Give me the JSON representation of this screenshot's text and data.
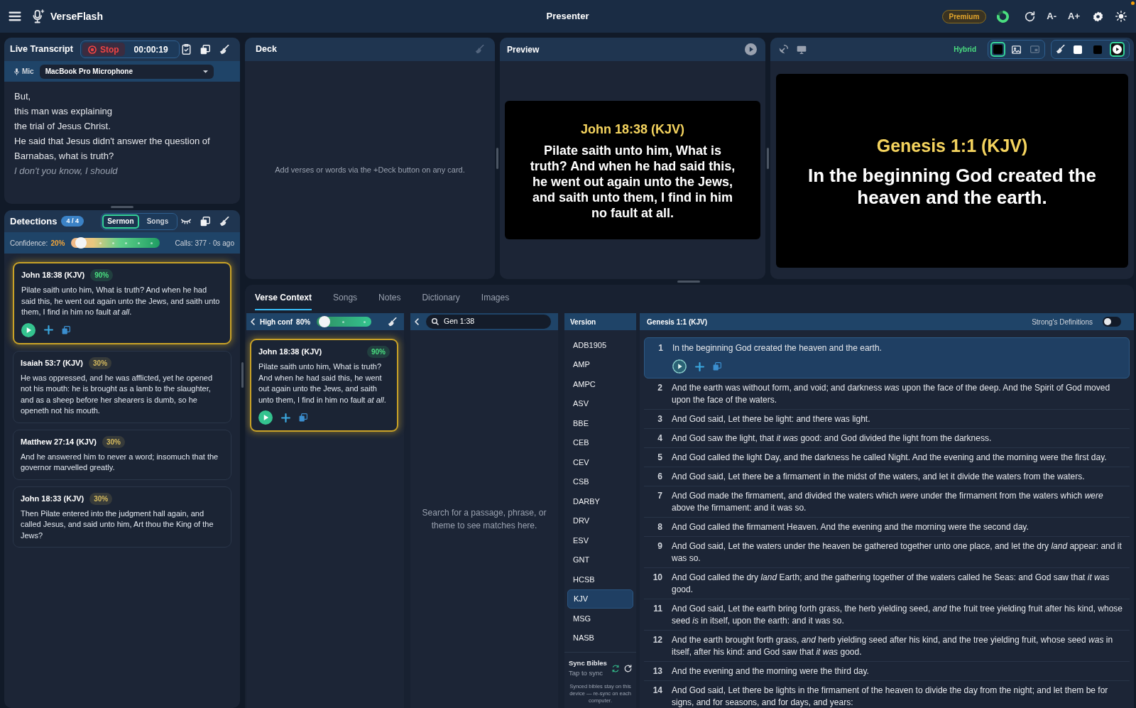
{
  "app_bar": {
    "app_name": "VerseFlash",
    "title": "Presenter",
    "premium": "Premium",
    "font_smaller": "A-",
    "font_larger": "A+"
  },
  "live_transcript": {
    "title": "Live Transcript",
    "stop": "Stop",
    "timer": "00:00:19",
    "mic_label": "Mic",
    "microphone": "MacBook Pro Microphone",
    "lines": [
      {
        "text": "But,",
        "interim": false
      },
      {
        "text": "this man was explaining",
        "interim": false
      },
      {
        "text": "the trial of Jesus Christ.",
        "interim": false
      },
      {
        "text": "He said that Jesus didn't answer the question of Barnabas, what is truth?",
        "interim": false
      },
      {
        "text": "I don't you know, I should",
        "interim": true
      }
    ]
  },
  "detections": {
    "title": "Detections",
    "count": "4 / 4",
    "modes": [
      {
        "label": "Sermon",
        "selected": true
      },
      {
        "label": "Songs",
        "selected": false
      }
    ],
    "confidence": {
      "label": "Confidence:",
      "value": "20%",
      "level": 0.05
    },
    "calls": "Calls: 377 · 0s ago",
    "cards": [
      {
        "reference": "John 18:38 (KJV)",
        "score": "90%",
        "color": "#4ade80",
        "selected": true,
        "text": "Pilate saith unto him, What is truth? And when he had said this, he went out again unto the Jews, and saith unto them, I find in him no fault *at all*."
      },
      {
        "reference": "Isaiah 53:7 (KJV)",
        "score": "30%",
        "color": "#d4b95e",
        "selected": false,
        "text": "He was oppressed, and he was afflicted, yet he opened not his mouth: he is brought as a lamb to the slaughter, and as a sheep before her shearers is dumb, so he openeth not his mouth."
      },
      {
        "reference": "Matthew 27:14 (KJV)",
        "score": "30%",
        "color": "#d4b95e",
        "selected": false,
        "text": "And he answered him to never a word; insomuch that the governor marvelled greatly."
      },
      {
        "reference": "John 18:33 (KJV)",
        "score": "30%",
        "color": "#d4b95e",
        "selected": false,
        "text": "Then Pilate entered into the judgment hall again, and called Jesus, and said unto him, Art thou the King of the Jews?"
      }
    ]
  },
  "deck": {
    "title": "Deck",
    "empty_message": "Add verses or words via the +Deck button on any card."
  },
  "preview": {
    "title": "Preview",
    "reference": "John 18:38 (KJV)",
    "text": "Pilate saith unto him, What is truth? And when he had said this, he went out again unto the Jews, and saith unto them, I find in him no fault at all."
  },
  "output": {
    "mode": "Hybrid",
    "background_modes": [
      {
        "kind": "solid",
        "selected": true,
        "disabled": false
      },
      {
        "kind": "image",
        "selected": false,
        "disabled": false
      },
      {
        "kind": "overlay",
        "selected": false,
        "disabled": true
      }
    ],
    "screen_modes": [
      {
        "kind": "white",
        "selected": false
      },
      {
        "kind": "black",
        "selected": false
      },
      {
        "kind": "live",
        "selected": true
      }
    ],
    "reference": "Genesis 1:1 (KJV)",
    "text": "In the beginning God created the heaven and the earth."
  },
  "context": {
    "tabs": [
      {
        "label": "Verse Context",
        "selected": true
      },
      {
        "label": "Songs",
        "selected": false
      },
      {
        "label": "Notes",
        "selected": false
      },
      {
        "label": "Dictionary",
        "selected": false
      },
      {
        "label": "Images",
        "selected": false
      }
    ],
    "high_confidence": {
      "label": "High conf",
      "value": "80%",
      "level": 0.05
    },
    "card": {
      "reference": "John 18:38 (KJV)",
      "score": "90%",
      "color": "#4ade80",
      "selected": true,
      "text": "Pilate saith unto him, What is truth? And when he had said this, he went out again unto the Jews, and saith unto them, I find in him no fault *at all*."
    },
    "search": {
      "value": "Gen 1:38",
      "empty_message": "Search for a passage, phrase, or theme to see matches here."
    },
    "versions": {
      "title": "Version",
      "items": [
        {
          "label": "ADB1905",
          "selected": false
        },
        {
          "label": "AMP",
          "selected": false
        },
        {
          "label": "AMPC",
          "selected": false
        },
        {
          "label": "ASV",
          "selected": false
        },
        {
          "label": "BBE",
          "selected": false
        },
        {
          "label": "CEB",
          "selected": false
        },
        {
          "label": "CEV",
          "selected": false
        },
        {
          "label": "CSB",
          "selected": false
        },
        {
          "label": "DARBY",
          "selected": false
        },
        {
          "label": "DRV",
          "selected": false
        },
        {
          "label": "ESV",
          "selected": false
        },
        {
          "label": "GNT",
          "selected": false
        },
        {
          "label": "HCSB",
          "selected": false
        },
        {
          "label": "KJV",
          "selected": true
        },
        {
          "label": "MSG",
          "selected": false
        },
        {
          "label": "NASB",
          "selected": false
        }
      ],
      "sync": {
        "title": "Sync Bibles",
        "hint": "Tap to sync",
        "note": "Synced bibles stay on this device — re-sync on each computer."
      }
    },
    "chapter": {
      "title": "Genesis 1:1 (KJV)",
      "strongs_definitions": {
        "label": "Strong's Definitions",
        "on": false
      },
      "verses": [
        {
          "number": "1",
          "selected": true,
          "text": "In the beginning God created the heaven and the earth."
        },
        {
          "number": "2",
          "selected": false,
          "text": "And the earth was without form, and void; and darkness *was* upon the face of the deep. And the Spirit of God moved upon the face of the waters."
        },
        {
          "number": "3",
          "selected": false,
          "text": "And God said, Let there be light: and there was light."
        },
        {
          "number": "4",
          "selected": false,
          "text": "And God saw the light, that *it was* good: and God divided the light from the darkness."
        },
        {
          "number": "5",
          "selected": false,
          "text": "And God called the light Day, and the darkness he called Night. And the evening and the morning were the first day."
        },
        {
          "number": "6",
          "selected": false,
          "text": "And God said, Let there be a firmament in the midst of the waters, and let it divide the waters from the waters."
        },
        {
          "number": "7",
          "selected": false,
          "text": "And God made the firmament, and divided the waters which *were* under the firmament from the waters which *were* above the firmament: and it was so."
        },
        {
          "number": "8",
          "selected": false,
          "text": "And God called the firmament Heaven. And the evening and the morning were the second day."
        },
        {
          "number": "9",
          "selected": false,
          "text": "And God said, Let the waters under the heaven be gathered together unto one place, and let the dry *land* appear: and it was so."
        },
        {
          "number": "10",
          "selected": false,
          "text": "And God called the dry *land* Earth; and the gathering together of the waters called he Seas: and God saw that *it was* good."
        },
        {
          "number": "11",
          "selected": false,
          "text": "And God said, Let the earth bring forth grass, the herb yielding seed, *and* the fruit tree yielding fruit after his kind, whose seed *is* in itself, upon the earth: and it was so."
        },
        {
          "number": "12",
          "selected": false,
          "text": "And the earth brought forth grass, *and* herb yielding seed after his kind, and the tree yielding fruit, whose seed *was* in itself, after his kind: and God saw that *it was* good."
        },
        {
          "number": "13",
          "selected": false,
          "text": "And the evening and the morning were the third day."
        },
        {
          "number": "14",
          "selected": false,
          "text": "And God said, Let there be lights in the firmament of the heaven to divide the day from the night; and let them be for signs, and for seasons, and for days, and years:"
        }
      ]
    }
  }
}
